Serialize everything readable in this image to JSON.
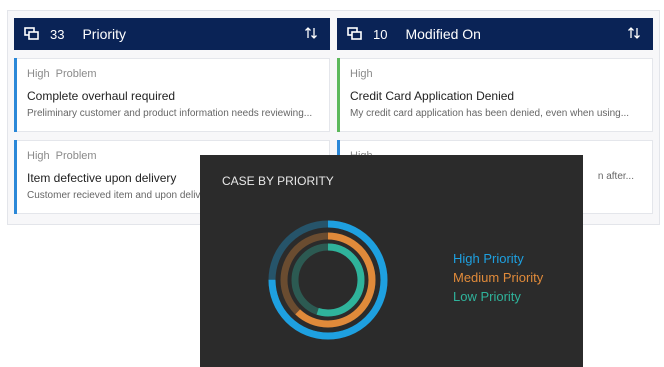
{
  "columns": [
    {
      "count": "33",
      "title": "Priority",
      "cards": [
        {
          "priority": "High",
          "type": "Problem",
          "title": "Complete overhaul required",
          "desc": "Preliminary customer and product information needs reviewing...",
          "accent": "#2b88d8"
        },
        {
          "priority": "High",
          "type": "Problem",
          "title": "Item defective upon delivery",
          "desc": "Customer recieved item and upon delive",
          "accent": "#2b88d8"
        }
      ]
    },
    {
      "count": "10",
      "title": "Modified On",
      "cards": [
        {
          "priority": "High",
          "type": "",
          "title": "Credit Card Application Denied",
          "desc": "My credit card application has been denied, even when using...",
          "accent": "#5cb85c"
        },
        {
          "priority": "High",
          "type": "",
          "title": "",
          "desc": "n after...",
          "accent": "#2b88d8"
        }
      ]
    }
  ],
  "popup": {
    "title": "CASE BY PRIORITY",
    "legend": [
      {
        "label": "High Priority",
        "color": "#1ea0e0",
        "fraction": 0.75
      },
      {
        "label": "Medium Priority",
        "color": "#e08a3a",
        "fraction": 0.62
      },
      {
        "label": "Low Priority",
        "color": "#2fb39b",
        "fraction": 0.55
      }
    ]
  }
}
